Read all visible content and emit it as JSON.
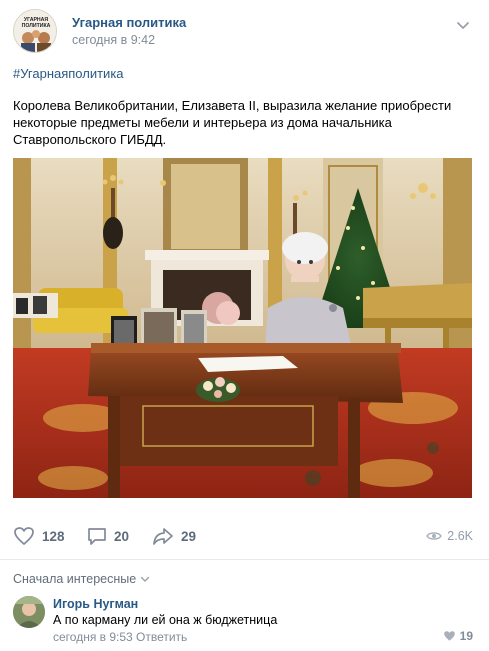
{
  "post": {
    "author": "Угарная политика",
    "time": "сегодня в 9:42",
    "hashtag": "#Угарнаяполитика",
    "text": "Королева Великобритании, Елизавета II, выразила желание приобрести некоторые предметы мебели и интерьера из дома начальника Ставропольского ГИБДД.",
    "avatar_text": "УГАРНАЯ ПОЛИТИКА"
  },
  "actions": {
    "likes": "128",
    "comments": "20",
    "shares": "29",
    "views": "2.6K"
  },
  "comments_section": {
    "sort_label": "Сначала интересные",
    "items": [
      {
        "author": "Игорь Нугман",
        "text": "А по карману ли ей она ж бюджетница",
        "time": "сегодня в 9:53",
        "reply_label": "Ответить",
        "likes": "19"
      }
    ]
  },
  "colors": {
    "link": "#2a5885",
    "muted": "#818c99",
    "icon": "#99a2ad",
    "carpet": "#b0341f",
    "desk": "#7a3a1a",
    "gold": "#c9a24a"
  },
  "icons": [
    "chevron-down-icon",
    "heart-icon",
    "comment-icon",
    "share-icon",
    "eye-icon",
    "small-chevron-icon",
    "small-heart-icon"
  ]
}
